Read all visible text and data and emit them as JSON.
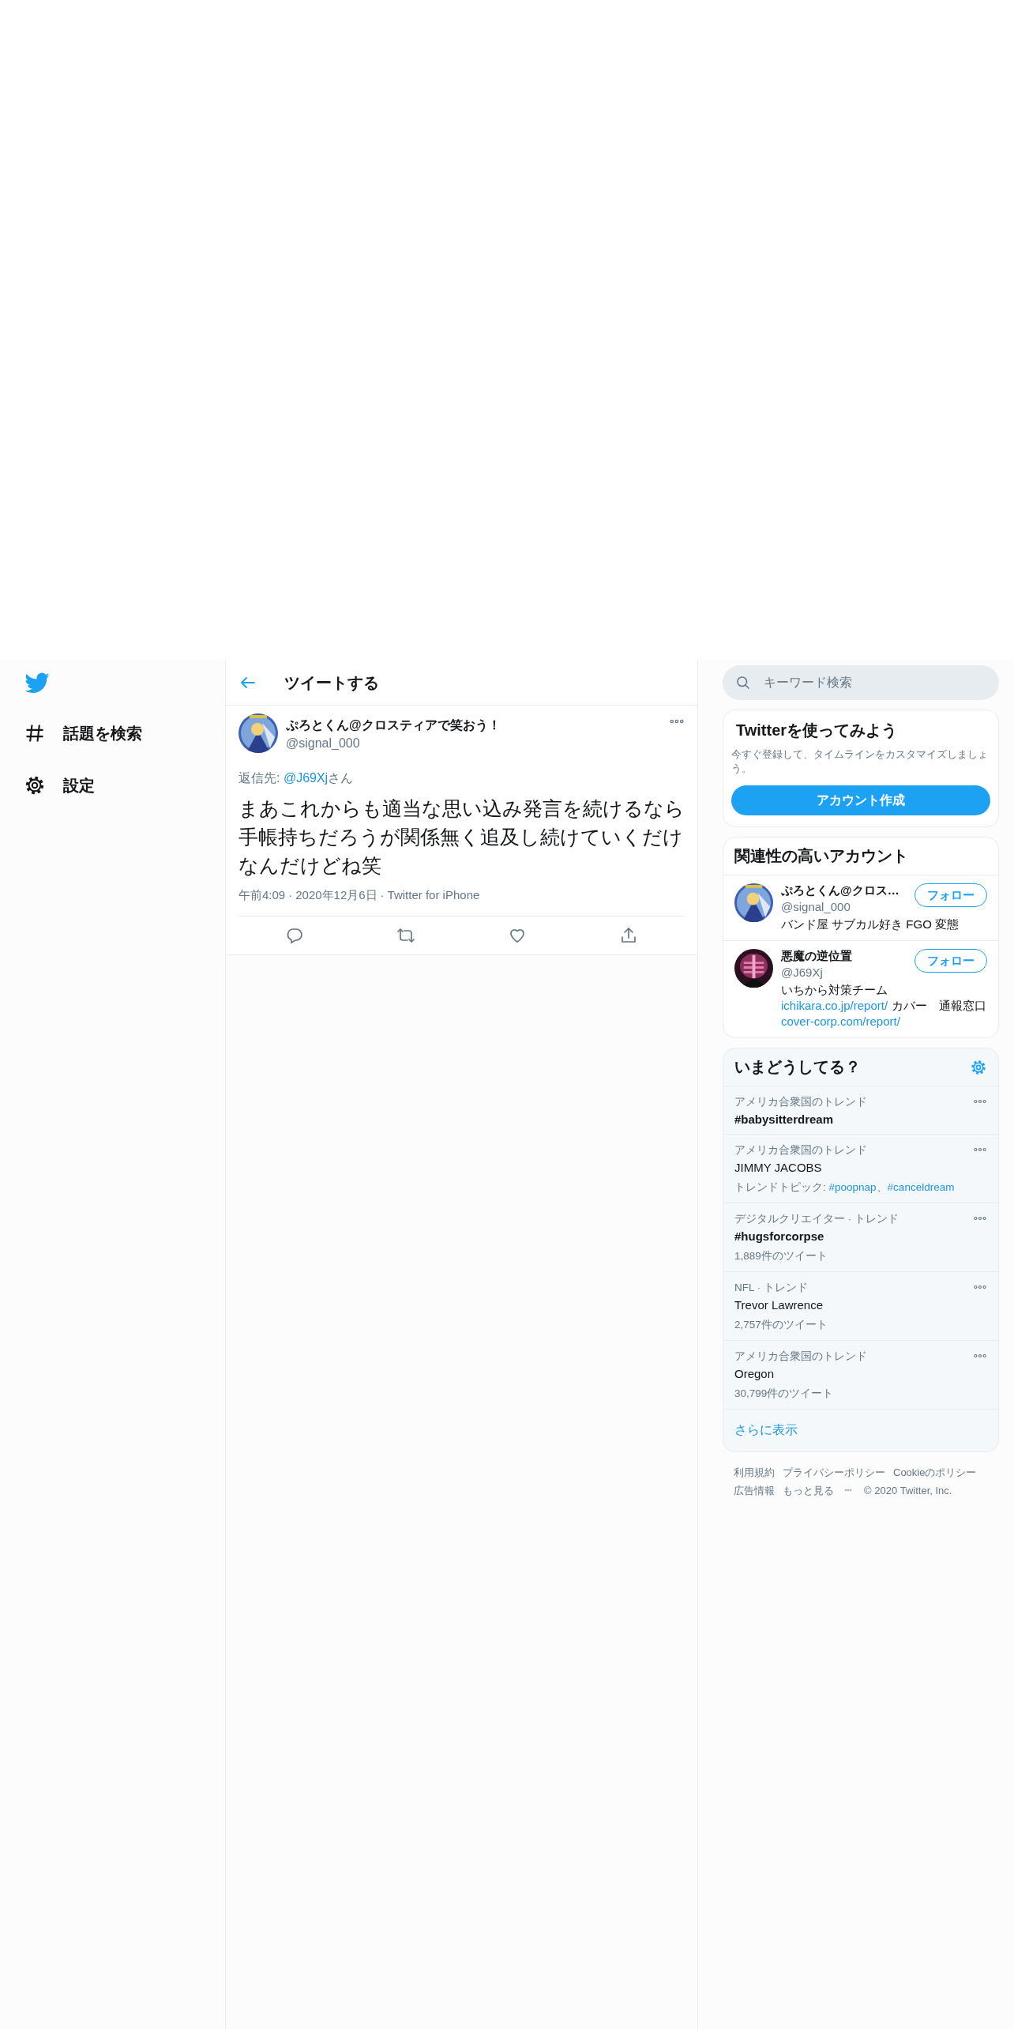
{
  "nav": {
    "items": [
      {
        "label": "話題を検索"
      },
      {
        "label": "設定"
      }
    ]
  },
  "header": {
    "title": "ツイートする"
  },
  "tweet": {
    "author_name": "ぷろとくん@クロスティアで笑おう！",
    "handle": "@signal_000",
    "reply_to_label": "返信先:",
    "reply_to": "@J69Xj",
    "reply_suffix": "さん",
    "text": "まあこれからも適当な思い込み発言を続けるなら手帳持ちだろうが関係無く追及し続けていくだけなんだけどね笑",
    "time": "午前4:09",
    "separator": "·",
    "date": "2020年12月6日",
    "source": "Twitter for iPhone"
  },
  "search": {
    "placeholder": "キーワード検索"
  },
  "signup": {
    "title": "Twitterを使ってみよう",
    "text": "今すぐ登録して、タイムラインをカスタマイズしましょう。",
    "button": "アカウント作成"
  },
  "who_to_follow": {
    "title": "関連性の高いアカウント",
    "accounts": [
      {
        "name": "ぷろとくん@クロス…",
        "handle": "@signal_000",
        "button": "フォロー",
        "bio": [
          {
            "segments": [
              {
                "kind": "text",
                "text": "バンド屋 サブカル好き FGO 変態"
              }
            ]
          }
        ]
      },
      {
        "name": "悪魔の逆位置",
        "handle": "@J69Xj",
        "button": "フォロー",
        "bio": [
          {
            "segments": [
              {
                "kind": "text",
                "text": "いちから対策チーム"
              }
            ]
          },
          {
            "segments": [
              {
                "kind": "link",
                "text": "ichikara.co.jp/report/"
              },
              {
                "kind": "text",
                "text": "カバー　通報窓口"
              }
            ]
          },
          {
            "segments": [
              {
                "kind": "link",
                "text": "cover-corp.com/report/"
              }
            ]
          }
        ]
      }
    ]
  },
  "trends": {
    "title": "いまどうしてる？",
    "items": [
      {
        "context": "アメリカ合衆国のトレンド",
        "name": "#babysitterdream",
        "kind": "hashtag"
      },
      {
        "context": "アメリカ合衆国のトレンド",
        "name": "JIMMY JACOBS",
        "kind": "topic",
        "related_label": "トレンドトピック:",
        "related": [
          "#poopnap",
          "#canceldream"
        ],
        "related_separator": "、"
      },
      {
        "context": "デジタルクリエイター · トレンド",
        "name": "#hugsforcorpse",
        "kind": "hashtag",
        "count": "1,889件のツイート"
      },
      {
        "context": "NFL · トレンド",
        "name": "Trevor Lawrence",
        "kind": "topic",
        "count": "2,757件のツイート"
      },
      {
        "context": "アメリカ合衆国のトレンド",
        "name": "Oregon",
        "kind": "topic",
        "count": "30,799件のツイート"
      }
    ],
    "show_more": "さらに表示"
  },
  "footer": {
    "links": [
      "利用規約",
      "プライバシーポリシー",
      "Cookieのポリシー",
      "広告情報",
      "もっと見る"
    ],
    "copyright": "© 2020 Twitter, Inc."
  }
}
